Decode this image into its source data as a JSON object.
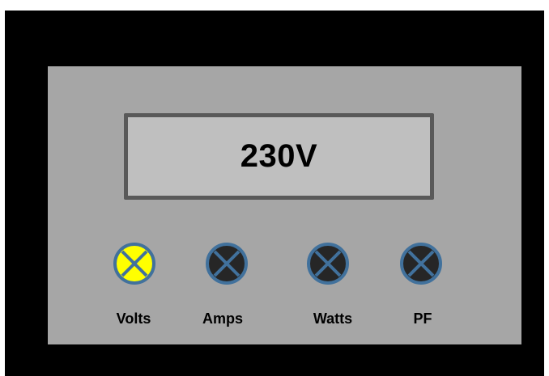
{
  "display": {
    "reading": "230V"
  },
  "indicators": [
    {
      "label": "Volts",
      "state": "on",
      "icon": "indicator-lamp-icon",
      "fill": "#ffff00"
    },
    {
      "label": "Amps",
      "state": "off",
      "icon": "indicator-lamp-icon",
      "fill": "#262626"
    },
    {
      "label": "Watts",
      "state": "off",
      "icon": "indicator-lamp-icon",
      "fill": "#262626"
    },
    {
      "label": "PF",
      "state": "off",
      "icon": "indicator-lamp-icon",
      "fill": "#262626"
    }
  ],
  "colors": {
    "frame": "#000000",
    "panel": "#a6a6a6",
    "display_background": "#bfbfbf",
    "display_border": "#595959",
    "lamp_ring": "#41719c",
    "lamp_on": "#ffff00",
    "lamp_off": "#262626"
  }
}
